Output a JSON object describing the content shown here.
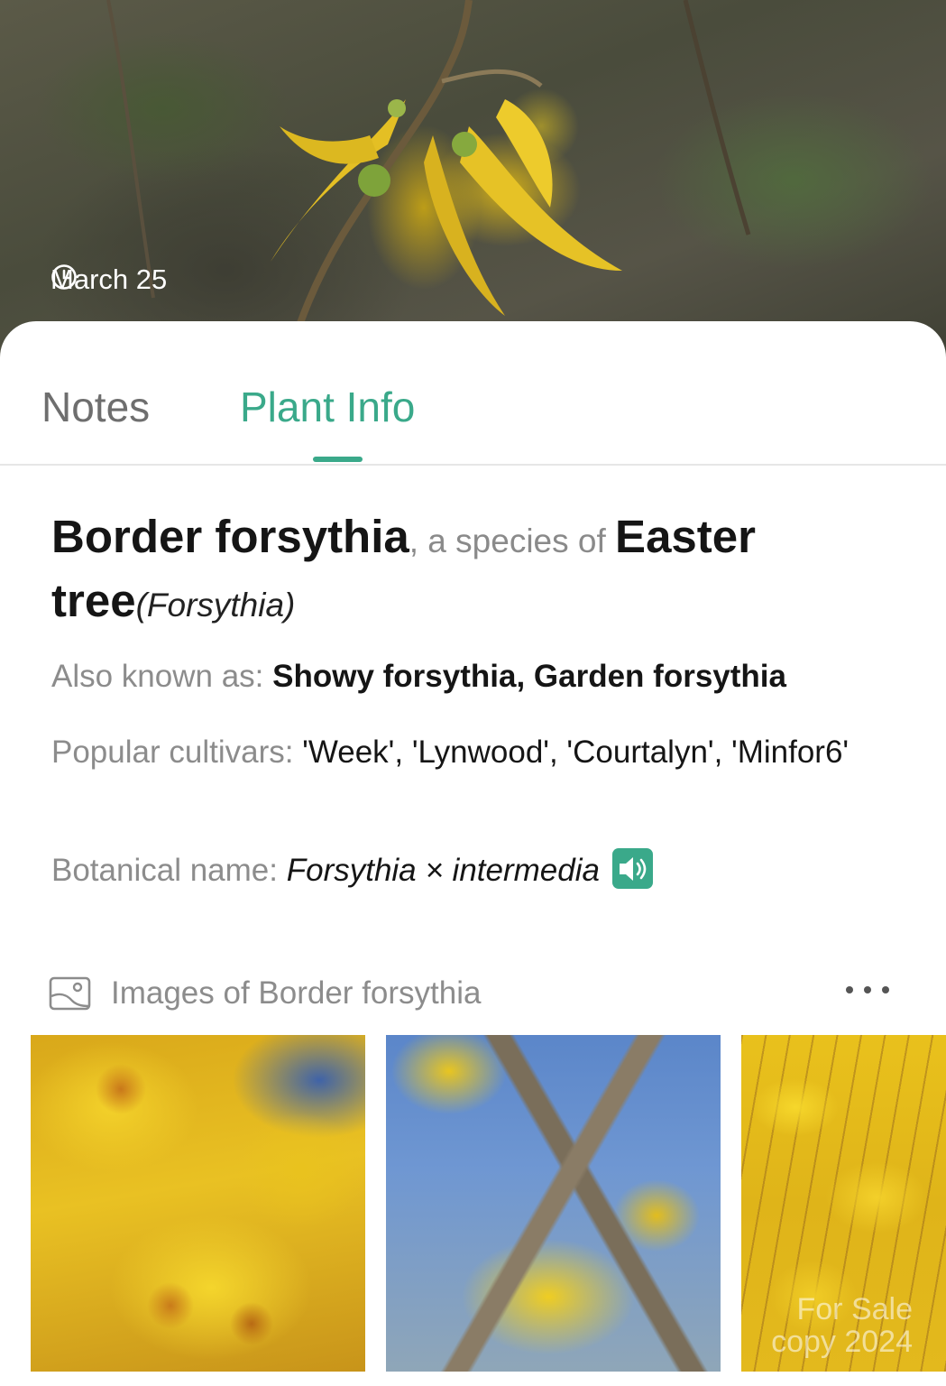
{
  "hero": {
    "date": "March 25",
    "clock_icon": "clock-icon"
  },
  "tabs": [
    {
      "label": "Notes",
      "active": false
    },
    {
      "label": "Plant Info",
      "active": true
    }
  ],
  "plant": {
    "common_name": "Border forsythia",
    "species_connector": ", a species of ",
    "genus_common": "Easter tree",
    "genus_scientific": "(Forsythia)"
  },
  "details": {
    "aka_label": "Also known as: ",
    "aka_value": "Showy forsythia, Garden forsythia",
    "cultivars_label": "Popular cultivars: ",
    "cultivars_value": "'Week', 'Lynwood', 'Courtalyn', 'Minfor6'",
    "botanical_label": "Botanical name: ",
    "botanical_value": "Forsythia × intermedia",
    "speaker_icon": "speaker-icon"
  },
  "images": {
    "header": "Images of Border forsythia",
    "header_icon": "image-icon",
    "more_icon": "more-icon",
    "watermark_line1": "For Sale",
    "watermark_line2": "copy 2024"
  },
  "colors": {
    "accent": "#3aa98a",
    "text_primary": "#151515",
    "text_secondary": "#8c8c8c"
  }
}
